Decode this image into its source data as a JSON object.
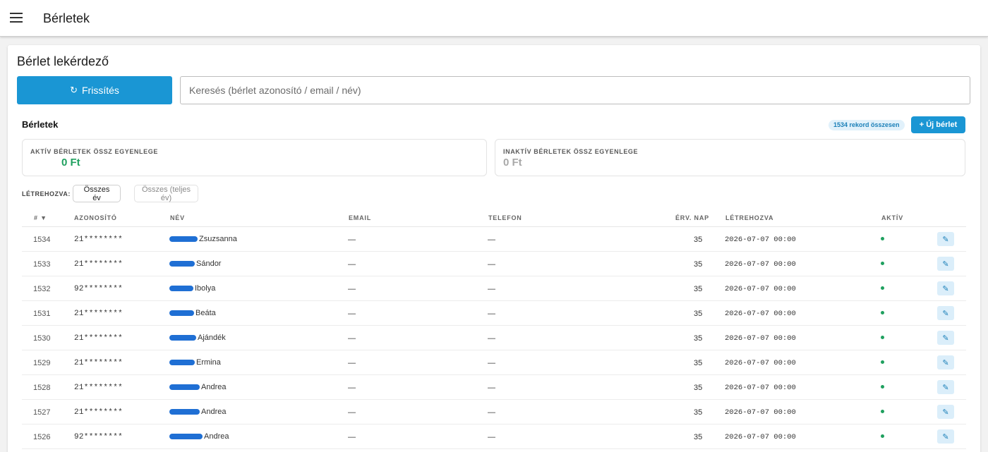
{
  "appbar": {
    "title": "Bérletek",
    "menu_icon": "hamburger-menu-icon"
  },
  "page": {
    "title": "Bérlet lekérdező"
  },
  "toolbar": {
    "refresh_label": "Frissítés",
    "refresh_icon": "↻",
    "search_placeholder": "Keresés (bérlet azonosító / email / név)"
  },
  "section": {
    "title": "Bérletek",
    "count_badge": "1534 rekord összesen",
    "new_button": "+ Új bérlet"
  },
  "summary": {
    "active": {
      "label": "AKTÍV BÉRLETEK ÖSSZ EGYENLEGE",
      "value": "0 Ft"
    },
    "inactive": {
      "label": "INAKTÍV BÉRLETEK ÖSSZ EGYENLEGE",
      "value": "0 Ft"
    }
  },
  "filter": {
    "label": "LÉTREHOZVA:",
    "options": [
      "Összes év",
      "Összes (teljes év)"
    ],
    "selected": "Összes év"
  },
  "table": {
    "headers": {
      "num": "# ▼",
      "id": "AZONOSÍTÓ",
      "name": "NÉV",
      "email": "EMAIL",
      "phone": "TELEFON",
      "days": "ÉRV. NAP",
      "created": "LÉTREHOZVA",
      "active": "AKTÍV"
    },
    "rows": [
      {
        "num": "1534",
        "id": "21********",
        "name": "Zsuzsanna",
        "email": "—",
        "phone": "—",
        "days": "35",
        "created": "2026-07-07 00:00",
        "active": true
      },
      {
        "num": "1533",
        "id": "21********",
        "name": "Sándor",
        "email": "—",
        "phone": "—",
        "days": "35",
        "created": "2026-07-07 00:00",
        "active": true
      },
      {
        "num": "1532",
        "id": "92********",
        "name": "Ibolya",
        "email": "—",
        "phone": "—",
        "days": "35",
        "created": "2026-07-07 00:00",
        "active": true
      },
      {
        "num": "1531",
        "id": "21********",
        "name": "Beáta",
        "email": "—",
        "phone": "—",
        "days": "35",
        "created": "2026-07-07 00:00",
        "active": true
      },
      {
        "num": "1530",
        "id": "21********",
        "name": "Ajándék",
        "email": "—",
        "phone": "—",
        "days": "35",
        "created": "2026-07-07 00:00",
        "active": true
      },
      {
        "num": "1529",
        "id": "21********",
        "name": "Ermina",
        "email": "—",
        "phone": "—",
        "days": "35",
        "created": "2026-07-07 00:00",
        "active": true
      },
      {
        "num": "1528",
        "id": "21********",
        "name": "Andrea",
        "email": "—",
        "phone": "—",
        "days": "35",
        "created": "2026-07-07 00:00",
        "active": true
      },
      {
        "num": "1527",
        "id": "21********",
        "name": "Andrea",
        "email": "—",
        "phone": "—",
        "days": "35",
        "created": "2026-07-07 00:00",
        "active": true
      },
      {
        "num": "1526",
        "id": "92********",
        "name": "Andrea",
        "email": "—",
        "phone": "—",
        "days": "35",
        "created": "2026-07-07 00:00",
        "active": true
      }
    ]
  },
  "colors": {
    "primary": "#1a96d4",
    "success": "#1fa05f",
    "redaction": "#1f6fd4"
  },
  "icons": {
    "refresh": "refresh-icon",
    "edit": "pencil-icon",
    "active_dot": "status-dot-icon"
  }
}
